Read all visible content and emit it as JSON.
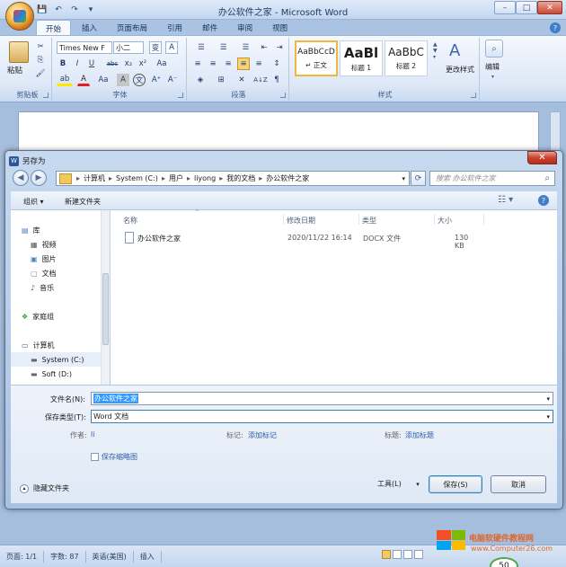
{
  "window": {
    "title": "办公软件之家 - Microsoft Word",
    "controls": {
      "minimize": "–",
      "maximize": "□",
      "close": "✕"
    }
  },
  "qat": {
    "save": "💾",
    "undo": "↶",
    "redo": "↷",
    "more": "▾"
  },
  "ribbon": {
    "tabs": [
      "开始",
      "插入",
      "页面布局",
      "引用",
      "邮件",
      "审阅",
      "视图"
    ],
    "active_tab": 0,
    "help": "?",
    "clipboard": {
      "label": "剪贴板",
      "paste": "粘贴",
      "cut": "✂",
      "copy": "⎘",
      "format": "🖌"
    },
    "font": {
      "label": "字体",
      "font_name": "Times New F",
      "font_size": "小二",
      "wen": "变",
      "a_box": "A",
      "bold": "B",
      "italic": "I",
      "underline": "U",
      "strike": "abc",
      "subscript": "x₂",
      "superscript": "x²",
      "clear": "Aa",
      "highlight": "ab",
      "font_color": "A",
      "case": "Aa",
      "char_box": "A",
      "phonetic": "文",
      "grow": "A⁺",
      "shrink": "A⁻"
    },
    "paragraph": {
      "label": "段落",
      "sort": "A↓Z"
    },
    "styles": {
      "label": "样式",
      "items": [
        {
          "preview": "AaBbCcD",
          "name": "↵ 正文"
        },
        {
          "preview": "AaBl",
          "name": "标题 1"
        },
        {
          "preview": "AaBbC",
          "name": "标题 2"
        }
      ],
      "change_styles": "更改样式"
    },
    "editing": {
      "label": "编辑"
    }
  },
  "status": {
    "page": "页面: 1/1",
    "words": "字数: 87",
    "lang": "英语(美国)",
    "insert": "插入",
    "zoom": "50"
  },
  "watermark": "电脑软硬件教程网",
  "watermark_url": "www.Computer26.com",
  "dialog": {
    "title": "另存为",
    "close": "✕",
    "breadcrumb": [
      "计算机",
      "System (C:)",
      "用户",
      "liyong",
      "我的文档",
      "办公软件之家"
    ],
    "search_placeholder": "搜索 办公软件之家",
    "toolbar": {
      "organize": "组织 ▾",
      "new_folder": "新建文件夹"
    },
    "nav": [
      {
        "label": "库",
        "icon": "library-icon",
        "level": 0
      },
      {
        "label": "视频",
        "icon": "video-icon",
        "level": 1
      },
      {
        "label": "图片",
        "icon": "pictures-icon",
        "level": 1
      },
      {
        "label": "文档",
        "icon": "documents-icon",
        "level": 1
      },
      {
        "label": "音乐",
        "icon": "music-icon",
        "level": 1
      },
      {
        "label": "家庭组",
        "icon": "homegroup-icon",
        "level": 0
      },
      {
        "label": "计算机",
        "icon": "computer-icon",
        "level": 0
      },
      {
        "label": "System (C:)",
        "icon": "drive-icon",
        "level": 1
      },
      {
        "label": "Soft (D:)",
        "icon": "drive-icon",
        "level": 1
      }
    ],
    "columns": {
      "name": "名称",
      "modified": "修改日期",
      "type": "类型",
      "size": "大小"
    },
    "files": [
      {
        "name": "办公软件之家",
        "modified": "2020/11/22 16:14",
        "type": "DOCX 文件",
        "size": "130 KB"
      }
    ],
    "filename_label": "文件名(N):",
    "filename_value": "办公软件之家",
    "filetype_label": "保存类型(T):",
    "filetype_value": "Word 文档",
    "author_label": "作者:",
    "author_value": "li",
    "tags_label": "标记:",
    "tags_value": "添加标记",
    "title_label": "标题:",
    "title_value": "添加标题",
    "thumbnail": "保存缩略图",
    "hide_folders": "隐藏文件夹",
    "tools": "工具(L)",
    "save": "保存(S)",
    "cancel": "取消"
  }
}
